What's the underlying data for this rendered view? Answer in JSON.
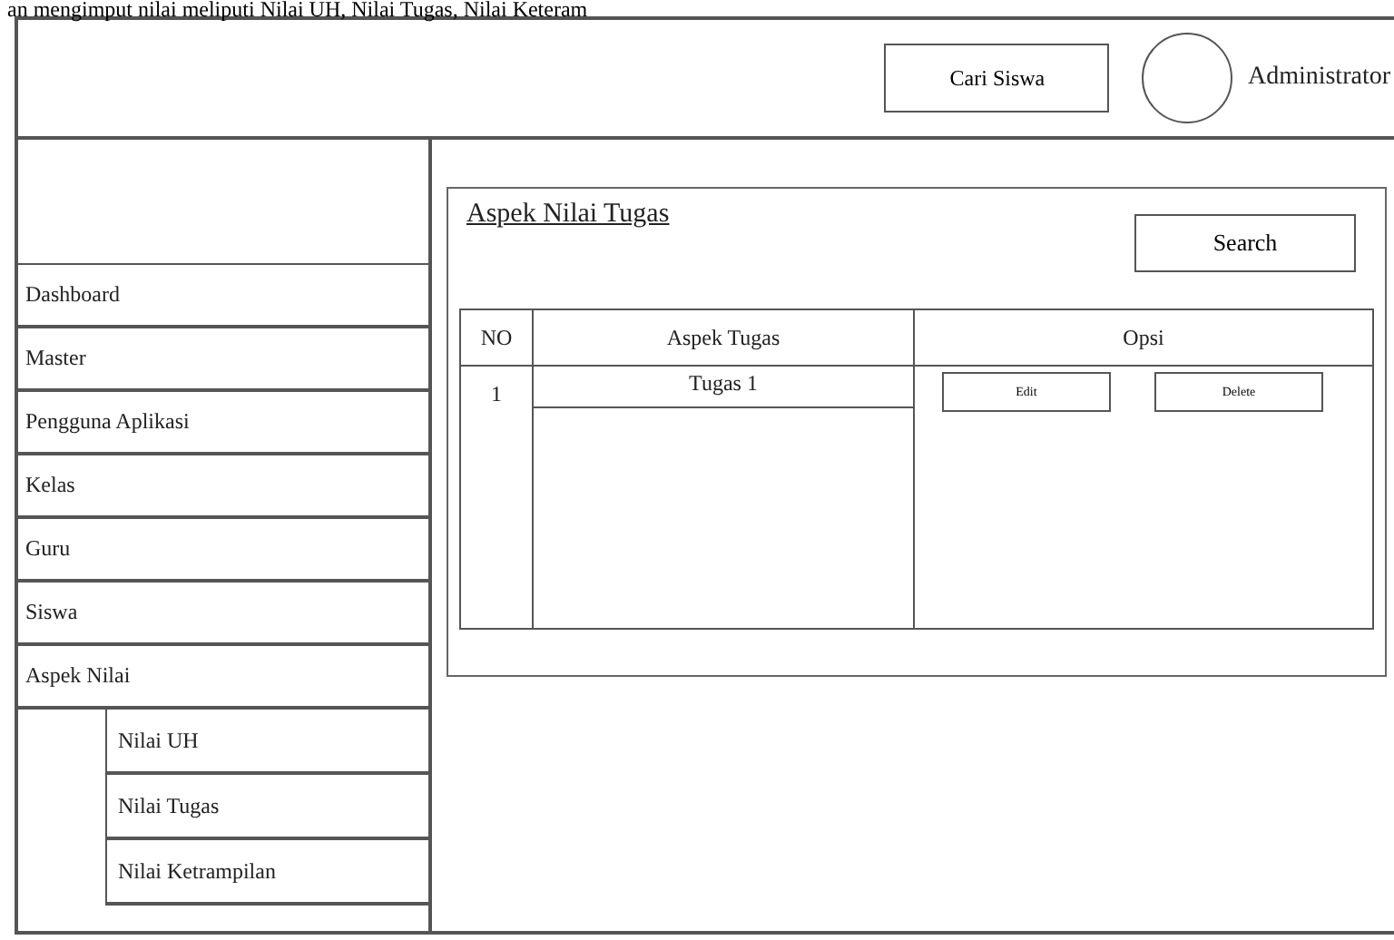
{
  "caption": "an mengimput nilai meliputi Nilai UH, Nilai Tugas, Nilai Keteram",
  "header": {
    "search_button": "Cari Siswa",
    "user": "Administrator"
  },
  "sidebar": {
    "items": [
      {
        "label": "Dashboard"
      },
      {
        "label": "Master"
      },
      {
        "label": "Pengguna Aplikasi"
      },
      {
        "label": "Kelas"
      },
      {
        "label": "Guru"
      },
      {
        "label": "Siswa"
      },
      {
        "label": "Aspek Nilai",
        "children": [
          {
            "label": "Nilai UH"
          },
          {
            "label": "Nilai Tugas"
          },
          {
            "label": "Nilai Ketrampilan"
          }
        ]
      }
    ]
  },
  "panel": {
    "title": "Aspek Nilai Tugas",
    "search_button": "Search",
    "table": {
      "columns": [
        "NO",
        "Aspek Tugas",
        "Opsi"
      ],
      "rows": [
        {
          "no": "1",
          "aspek": "Tugas 1",
          "actions": [
            "Edit",
            "Delete"
          ]
        }
      ]
    }
  }
}
